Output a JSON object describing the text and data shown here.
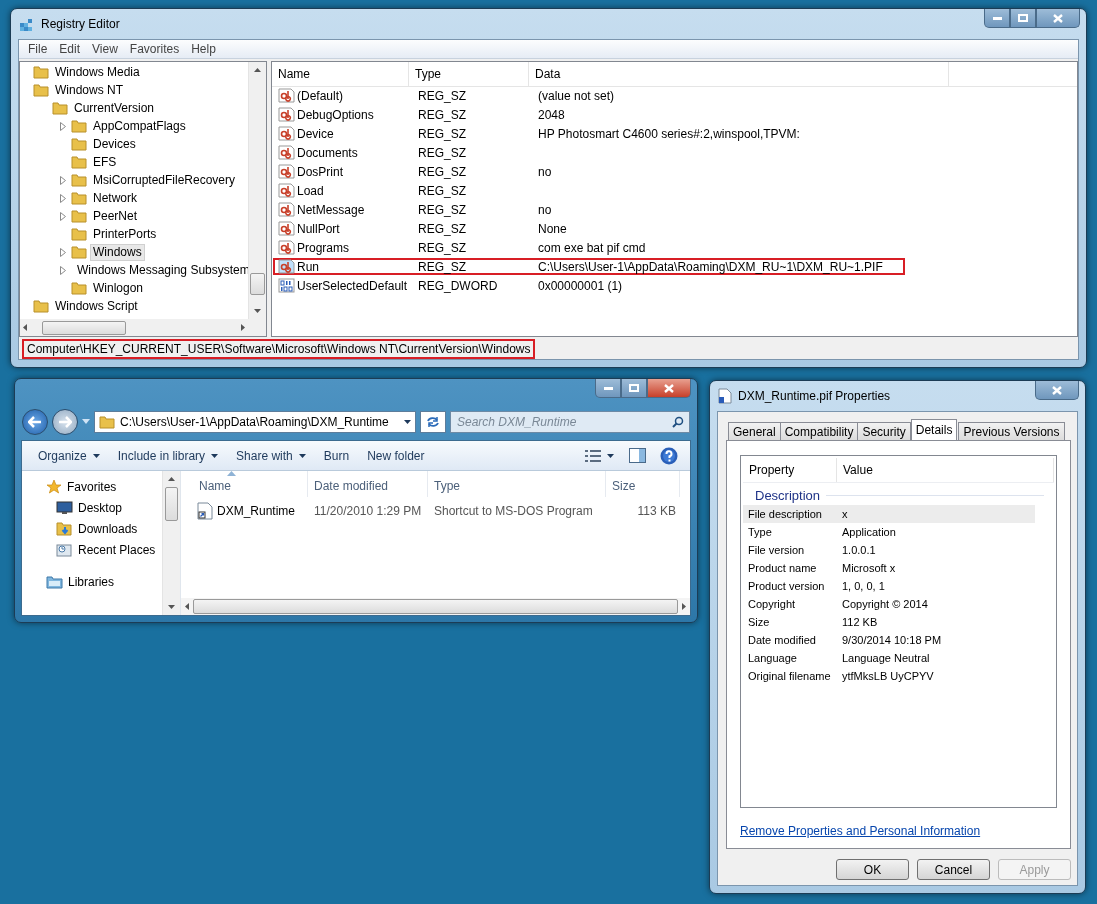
{
  "registry": {
    "title": "Registry Editor",
    "menu": [
      "File",
      "Edit",
      "View",
      "Favorites",
      "Help"
    ],
    "tree": [
      {
        "label": "Windows Media",
        "expandable": false,
        "selected": false
      },
      {
        "label": "Windows NT",
        "expandable": false,
        "selected": false,
        "children": [
          {
            "label": "CurrentVersion",
            "expandable": false,
            "selected": false,
            "children": [
              {
                "label": "AppCompatFlags",
                "expandable": true,
                "selected": false
              },
              {
                "label": "Devices",
                "expandable": false,
                "selected": false
              },
              {
                "label": "EFS",
                "expandable": false,
                "selected": false
              },
              {
                "label": "MsiCorruptedFileRecovery",
                "expandable": true,
                "selected": false
              },
              {
                "label": "Network",
                "expandable": true,
                "selected": false
              },
              {
                "label": "PeerNet",
                "expandable": true,
                "selected": false
              },
              {
                "label": "PrinterPorts",
                "expandable": false,
                "selected": false
              },
              {
                "label": "Windows",
                "expandable": true,
                "selected": true
              },
              {
                "label": "Windows Messaging Subsystem",
                "expandable": true,
                "selected": false
              },
              {
                "label": "Winlogon",
                "expandable": false,
                "selected": false
              }
            ]
          }
        ]
      },
      {
        "label": "Windows Script",
        "expandable": false,
        "selected": false
      }
    ],
    "columns": [
      "Name",
      "Type",
      "Data"
    ],
    "rows": [
      {
        "kind": "string",
        "name": "(Default)",
        "type": "REG_SZ",
        "data": "(value not set)",
        "selected": false,
        "outlined": false
      },
      {
        "kind": "string",
        "name": "DebugOptions",
        "type": "REG_SZ",
        "data": "2048",
        "selected": false,
        "outlined": false
      },
      {
        "kind": "string",
        "name": "Device",
        "type": "REG_SZ",
        "data": "HP Photosmart C4600 series#:2,winspool,TPVM:",
        "selected": false,
        "outlined": false
      },
      {
        "kind": "string",
        "name": "Documents",
        "type": "REG_SZ",
        "selected": false,
        "outlined": false
      },
      {
        "kind": "string",
        "name": "DosPrint",
        "type": "REG_SZ",
        "data": "no",
        "selected": false,
        "outlined": false
      },
      {
        "kind": "string",
        "name": "Load",
        "type": "REG_SZ",
        "selected": false,
        "outlined": false
      },
      {
        "kind": "string",
        "name": "NetMessage",
        "type": "REG_SZ",
        "data": "no",
        "selected": false,
        "outlined": false
      },
      {
        "kind": "string",
        "name": "NullPort",
        "type": "REG_SZ",
        "data": "None",
        "selected": false,
        "outlined": false
      },
      {
        "kind": "string",
        "name": "Programs",
        "type": "REG_SZ",
        "data": "com exe bat pif cmd",
        "selected": false,
        "outlined": false
      },
      {
        "kind": "string",
        "name": "Run",
        "type": "REG_SZ",
        "data": "C:\\Users\\User-1\\AppData\\Roaming\\DXM_RU~1\\DXM_RU~1.PIF",
        "selected": true,
        "outlined": true
      },
      {
        "kind": "dword",
        "name": "UserSelectedDefault",
        "type": "REG_DWORD",
        "data": "0x00000001 (1)",
        "selected": false,
        "outlined": false
      }
    ],
    "status_bar": {
      "path": "Computer\\HKEY_CURRENT_USER\\Software\\Microsoft\\Windows NT\\CurrentVersion\\Windows",
      "outlined": true
    }
  },
  "explorer": {
    "address": "C:\\Users\\User-1\\AppData\\Roaming\\DXM_Runtime",
    "search": {
      "placeholder": "Search DXM_Runtime"
    },
    "toolbar": [
      {
        "label": "Organize",
        "dropdown": true
      },
      {
        "label": "Include in library",
        "dropdown": true
      },
      {
        "label": "Share with",
        "dropdown": true
      },
      {
        "label": "Burn",
        "dropdown": false
      },
      {
        "label": "New folder",
        "dropdown": false
      }
    ],
    "nav": [
      {
        "kind": "group",
        "label": "Favorites"
      },
      {
        "kind": "item",
        "label": "Desktop"
      },
      {
        "kind": "item",
        "label": "Downloads"
      },
      {
        "kind": "item",
        "label": "Recent Places"
      },
      {
        "kind": "group",
        "label": "Libraries"
      }
    ],
    "columns": [
      {
        "label": "Name",
        "sorted": true
      },
      {
        "label": "Date modified",
        "sorted": false
      },
      {
        "label": "Type",
        "sorted": false
      },
      {
        "label": "Size",
        "sorted": false
      }
    ],
    "files": [
      {
        "name": "DXM_Runtime",
        "date": "11/20/2010 1:29 PM",
        "type": "Shortcut to MS-DOS Program",
        "size": "113 KB"
      }
    ]
  },
  "properties": {
    "title": "DXM_Runtime.pif Properties",
    "tabs": [
      {
        "label": "General",
        "selected": false
      },
      {
        "label": "Compatibility",
        "selected": false
      },
      {
        "label": "Security",
        "selected": false
      },
      {
        "label": "Details",
        "selected": true
      },
      {
        "label": "Previous Versions",
        "selected": false
      }
    ],
    "columns": [
      "Property",
      "Value"
    ],
    "section": "Description",
    "rows": [
      {
        "property": "File description",
        "value": "x",
        "selected": true
      },
      {
        "property": "Type",
        "value": "Application",
        "selected": false
      },
      {
        "property": "File version",
        "value": "1.0.0.1",
        "selected": false
      },
      {
        "property": "Product name",
        "value": "Microsoft x",
        "selected": false
      },
      {
        "property": "Product version",
        "value": "1, 0, 0, 1",
        "selected": false
      },
      {
        "property": "Copyright",
        "value": "Copyright © 2014",
        "selected": false
      },
      {
        "property": "Size",
        "value": "112 KB",
        "selected": false
      },
      {
        "property": "Date modified",
        "value": "9/30/2014 10:18 PM",
        "selected": false
      },
      {
        "property": "Language",
        "value": "Language Neutral",
        "selected": false
      },
      {
        "property": "Original filename",
        "value": "ytfMksLB UyCPYV",
        "selected": false
      }
    ],
    "link": "Remove Properties and Personal Information",
    "buttons": [
      {
        "label": "OK",
        "disabled": false
      },
      {
        "label": "Cancel",
        "disabled": false
      },
      {
        "label": "Apply",
        "disabled": true
      }
    ]
  }
}
